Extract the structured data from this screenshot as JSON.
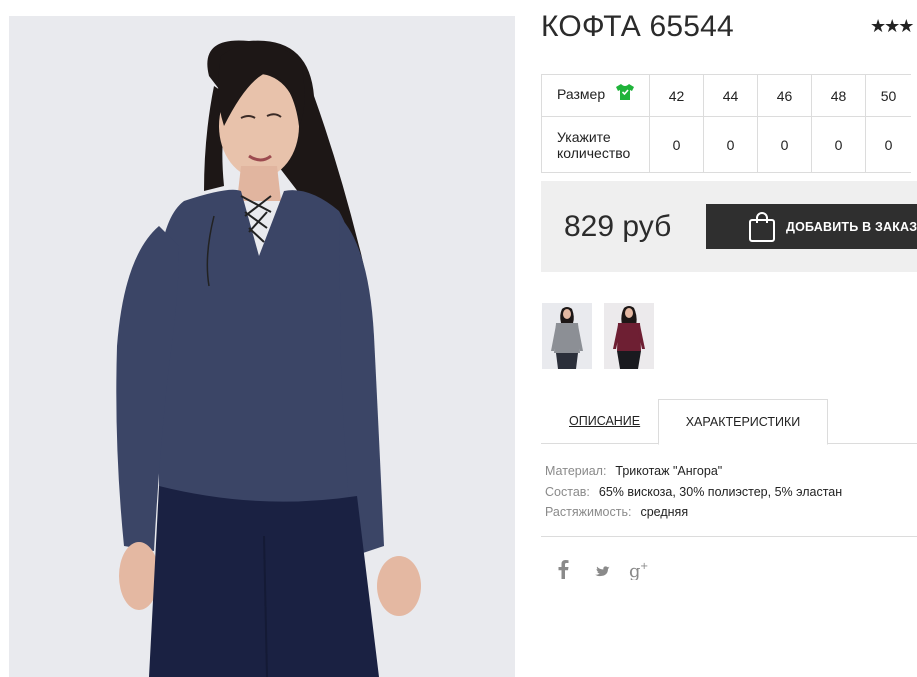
{
  "product": {
    "title": "КОФТА 65544",
    "rating_stars": "★★★",
    "price": "829 руб",
    "add_button_label": "ДОБАВИТЬ В ЗАКАЗ"
  },
  "size_table": {
    "size_label": "Размер",
    "qty_label": "Укажите количество",
    "sizes": [
      "42",
      "44",
      "46",
      "48",
      "50"
    ],
    "quantities": [
      "0",
      "0",
      "0",
      "0",
      "0"
    ]
  },
  "tabs": [
    {
      "label": "ОПИСАНИЕ",
      "active": false
    },
    {
      "label": "ХАРАКТЕРИСТИКИ",
      "active": true
    }
  ],
  "specs": [
    {
      "key": "Материал:",
      "value": "Трикотаж \"Ангора\""
    },
    {
      "key": "Состав:",
      "value": "65% вискоза, 30% полиэстер, 5% эластан"
    },
    {
      "key": "Растяжимость:",
      "value": "средняя"
    }
  ],
  "thumbnails": [
    {
      "name": "thumbnail-grey",
      "color": "#8c8f95"
    },
    {
      "name": "thumbnail-burgundy",
      "color": "#6e1f33"
    }
  ],
  "social": [
    "facebook-icon",
    "twitter-icon",
    "google-plus-icon"
  ],
  "colors": {
    "button_bg": "#2f2f2f",
    "price_box_bg": "#efefef",
    "shirt_icon": "#1fb33a",
    "sweater": "#3b4566"
  }
}
